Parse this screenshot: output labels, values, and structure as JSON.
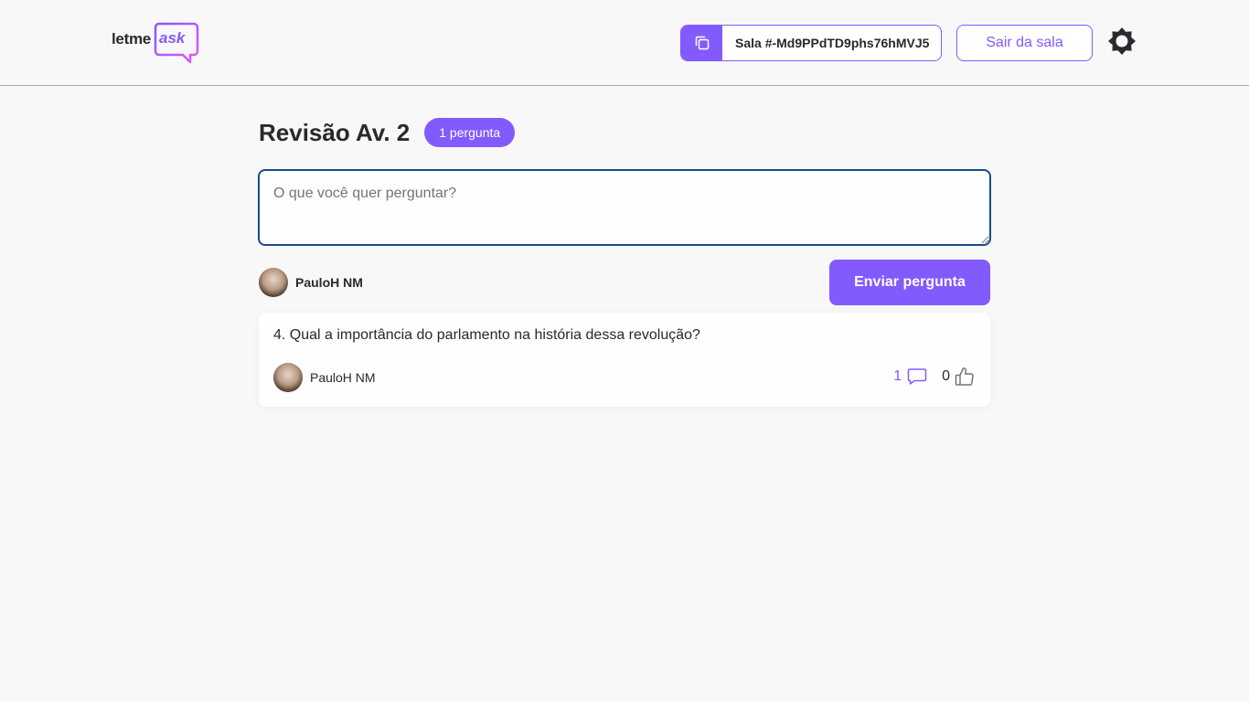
{
  "header": {
    "logo_text": "letme",
    "logo_accent": "ask",
    "room_code_label": "Sala #-Md9PPdTD9phs76hMVJ5",
    "leave_label": "Sair da sala",
    "theme_icon": "sun-icon"
  },
  "room": {
    "title": "Revisão Av. 2",
    "question_count": "1 pergunta"
  },
  "form": {
    "placeholder": "O que você quer perguntar?",
    "user_name": "PauloH NM",
    "send_label": "Enviar pergunta"
  },
  "questions": [
    {
      "content": "4. Qual a importância do parlamento na história dessa revolução?",
      "author": "PauloH NM",
      "replies": "1",
      "likes": "0"
    }
  ],
  "colors": {
    "accent": "#835afd",
    "background": "#f8f8f8",
    "text": "#29292e"
  }
}
